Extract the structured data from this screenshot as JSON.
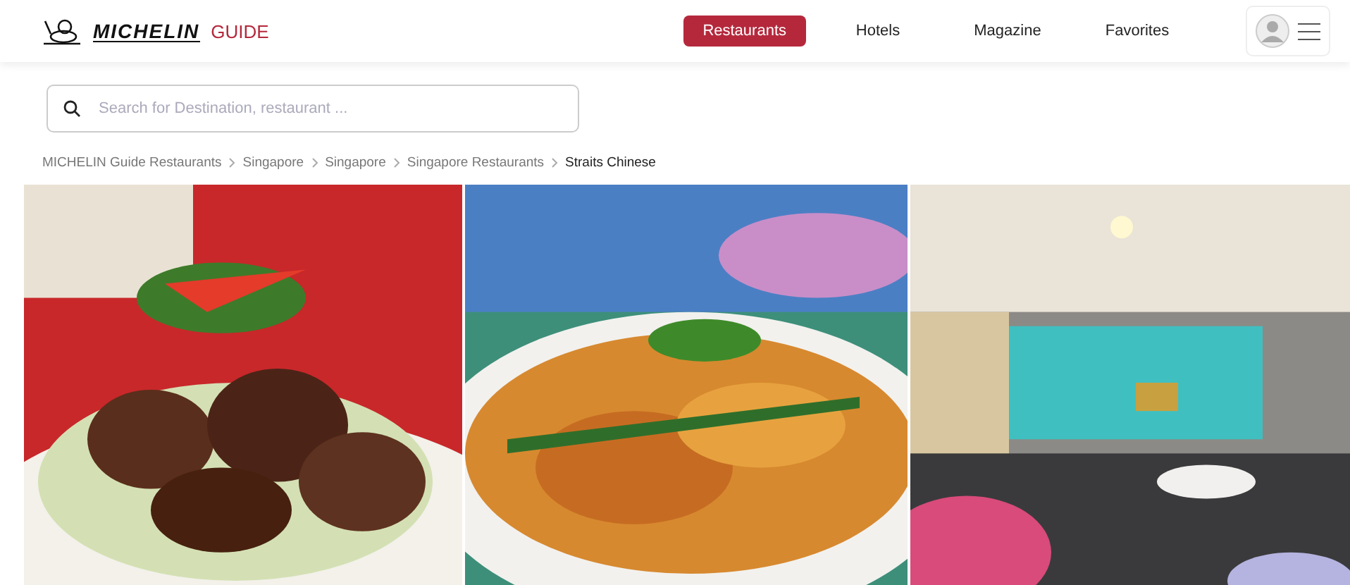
{
  "header": {
    "logo": {
      "wordmark": "MICHELIN",
      "suffix": "GUIDE"
    },
    "nav": [
      {
        "label": "Restaurants",
        "selected": true
      },
      {
        "label": "Hotels",
        "selected": false
      },
      {
        "label": "Magazine",
        "selected": false
      },
      {
        "label": "Favorites",
        "selected": false
      }
    ]
  },
  "search": {
    "placeholder": "Search for Destination, restaurant ..."
  },
  "breadcrumb": [
    {
      "label": "MICHELIN Guide Restaurants",
      "current": false
    },
    {
      "label": "Singapore",
      "current": false
    },
    {
      "label": "Singapore",
      "current": false
    },
    {
      "label": "Singapore Restaurants",
      "current": false
    },
    {
      "label": "Straits Chinese",
      "current": true
    }
  ]
}
